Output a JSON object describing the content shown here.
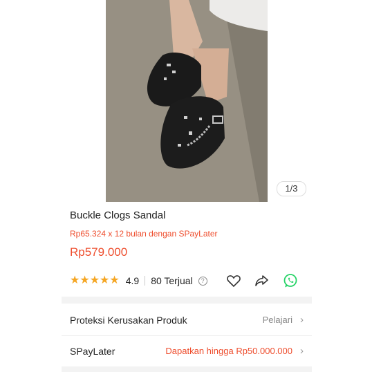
{
  "image": {
    "counter": "1/3"
  },
  "product": {
    "title": "Buckle Clogs Sandal",
    "installment": "Rp65.324 x 12 bulan dengan SPayLater",
    "price": "Rp579.000",
    "rating": "4.9",
    "rating_stars": 4.9,
    "sold": "80 Terjual"
  },
  "actions": [
    "heart-icon",
    "share-icon",
    "whatsapp-icon"
  ],
  "rows": [
    {
      "label": "Proteksi Kerusakan Produk",
      "value": "Pelajari",
      "value_color": "#888888"
    },
    {
      "label": "SPayLater",
      "value": "Dapatkan hingga Rp50.000.000",
      "value_color": "#ee4d2d"
    }
  ],
  "colors": {
    "accent": "#ee4d2d",
    "star": "#f5a623",
    "whatsapp": "#25d366"
  }
}
